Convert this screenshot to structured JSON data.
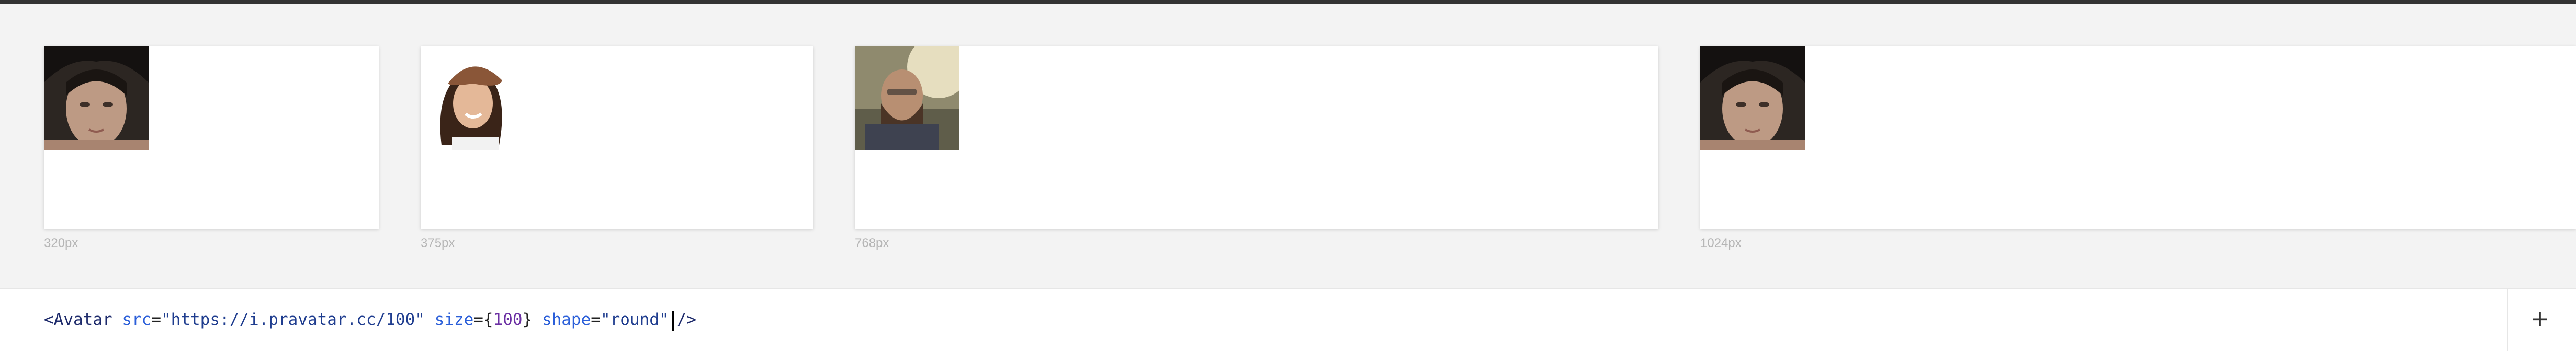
{
  "frames": [
    {
      "label": "320px",
      "avatar": "woman-dark-hat"
    },
    {
      "label": "375px",
      "avatar": "woman-brown-cap"
    },
    {
      "label": "768px",
      "avatar": "man-bearded-sunlight"
    },
    {
      "label": "1024px",
      "avatar": "woman-dark-hat"
    }
  ],
  "editor": {
    "tag_open": "<Avatar",
    "attr_src": "src",
    "eq1": "=",
    "src_value": "\"https://i.pravatar.cc/100\"",
    "attr_size": "size",
    "eq2": "=",
    "brace_open": "{",
    "size_value": "100",
    "brace_close": "}",
    "attr_shape": "shape",
    "eq3": "=",
    "shape_value": "\"round\"",
    "tag_close": "/>"
  },
  "toolbar": {
    "add_label": "+",
    "add_icon": "plus-icon"
  },
  "colors": {
    "background": "#f3f3f3",
    "frame": "#ffffff",
    "topbar": "#333333",
    "label": "#b5b5b5",
    "code_attr": "#2b5fd9",
    "code_string": "#1f3d8f",
    "code_number": "#6b2fa3"
  }
}
